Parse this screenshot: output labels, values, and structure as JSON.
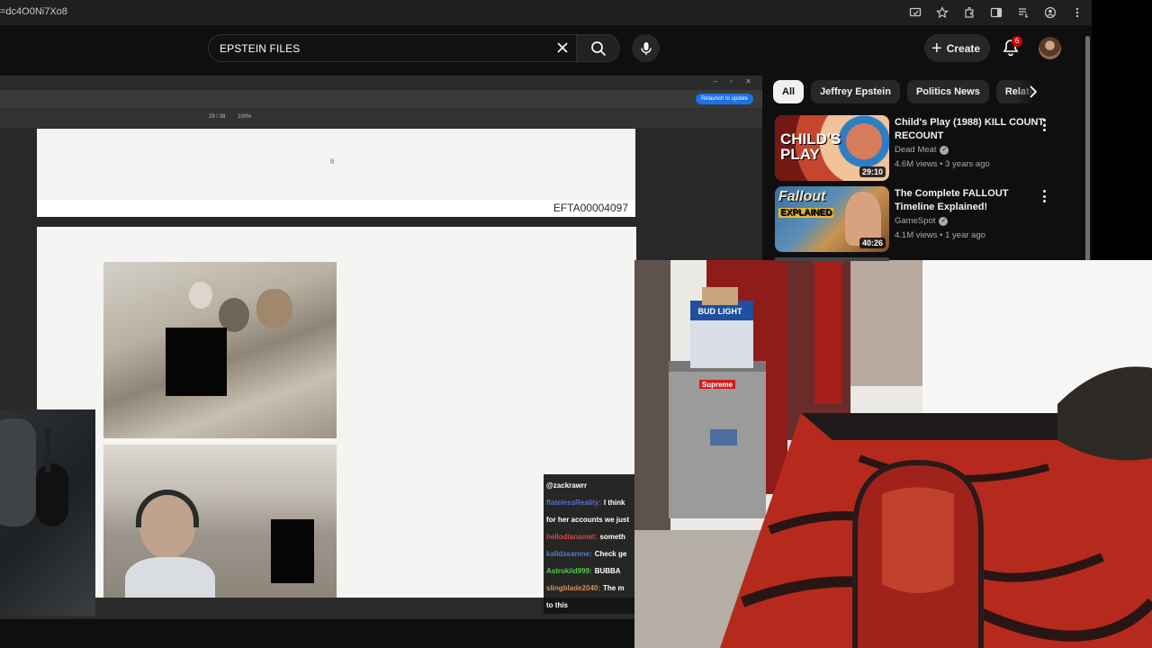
{
  "browser": {
    "url_fragment": "=dc4O0Ni7Xo8"
  },
  "header": {
    "search_value": "EPSTEIN FILES",
    "create_label": "Create",
    "notification_count": "6"
  },
  "chips": [
    {
      "label": "All",
      "active": true
    },
    {
      "label": "Jeffrey Epstein",
      "active": false
    },
    {
      "label": "Politics News",
      "active": false
    },
    {
      "label": "Relatec",
      "active": false
    }
  ],
  "related": [
    {
      "title": "Child's Play (1988) KILL COUNT: RECOUNT",
      "channel": "Dead Meat",
      "meta": "4.6M views • 3 years ago",
      "duration": "29:10",
      "thumb_text_top": "CHILD'S",
      "thumb_text_bottom": "PLAY"
    },
    {
      "title": "The Complete FALLOUT Timeline Explained!",
      "channel": "GameSpot",
      "meta": "4.1M views • 1 year ago",
      "duration": "40:26",
      "thumb_text_top": "Fallout",
      "thumb_text_bottom": "EXPLAINED"
    }
  ],
  "pdf": {
    "page_indicator": "29 / 38",
    "zoom": "100%",
    "page_number": "6",
    "doc_id": "EFTA00004097",
    "update_button": "Relaunch to update"
  },
  "chat": [
    {
      "user": "@zackrawrr",
      "msg": "",
      "color": "#ffffff"
    },
    {
      "user": "flatelessReality:",
      "msg": "I think",
      "color": "#5b6bd6"
    },
    {
      "user": "",
      "msg": "for her accounts we just",
      "color": "#ffffff"
    },
    {
      "user": "hellodianamet:",
      "msg": "someth",
      "color": "#d04b4b"
    },
    {
      "user": "kalldasanme:",
      "msg": "Check ge",
      "color": "#4f7bd6"
    },
    {
      "user": "Astrokiid999:",
      "msg": "BUBBA",
      "color": "#57c957"
    },
    {
      "user": "slingblade2040:",
      "msg": "The m",
      "color": "#e08a48"
    },
    {
      "user": "",
      "msg": "to this",
      "color": "#ffffff"
    }
  ],
  "room": {
    "box_label": "BUD LIGHT",
    "fridge_sticker": "Supreme"
  },
  "colors": {
    "accent_red": "#cc0000",
    "bg": "#0f0f0f",
    "chip_bg": "#272727"
  }
}
